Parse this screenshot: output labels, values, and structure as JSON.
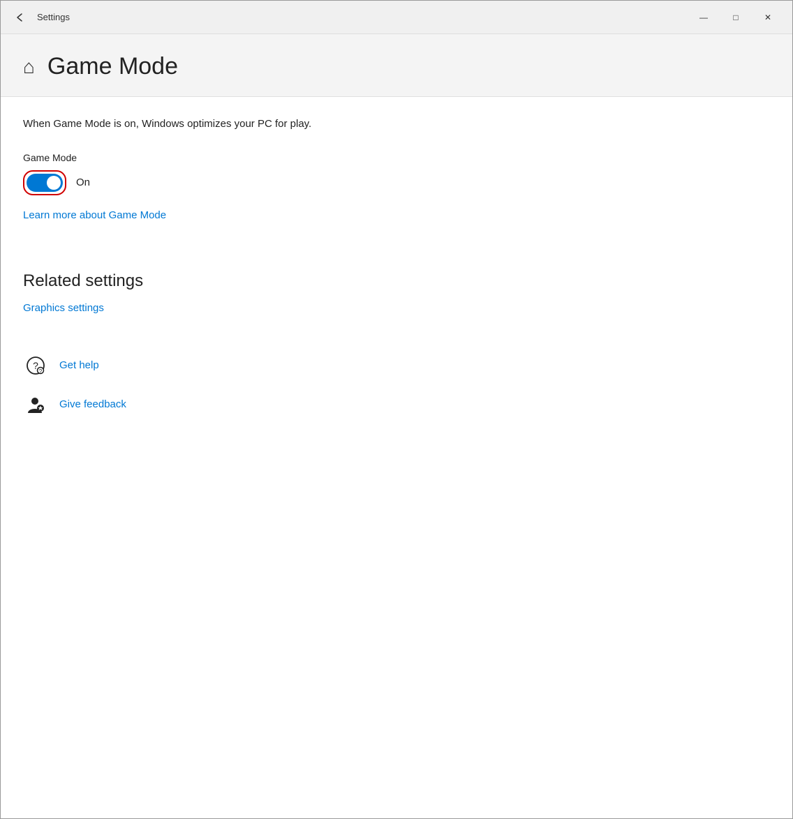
{
  "window": {
    "title": "Settings",
    "controls": {
      "minimize": "—",
      "maximize": "□",
      "close": "✕"
    }
  },
  "header": {
    "icon": "⌂",
    "title": "Game Mode"
  },
  "content": {
    "description": "When Game Mode is on, Windows optimizes your PC for play.",
    "game_mode_label": "Game Mode",
    "toggle_state": "On",
    "toggle_on": true,
    "learn_more_link": "Learn more about Game Mode",
    "related_settings_title": "Related settings",
    "graphics_settings_link": "Graphics settings",
    "help": {
      "get_help_label": "Get help",
      "give_feedback_label": "Give feedback"
    }
  }
}
